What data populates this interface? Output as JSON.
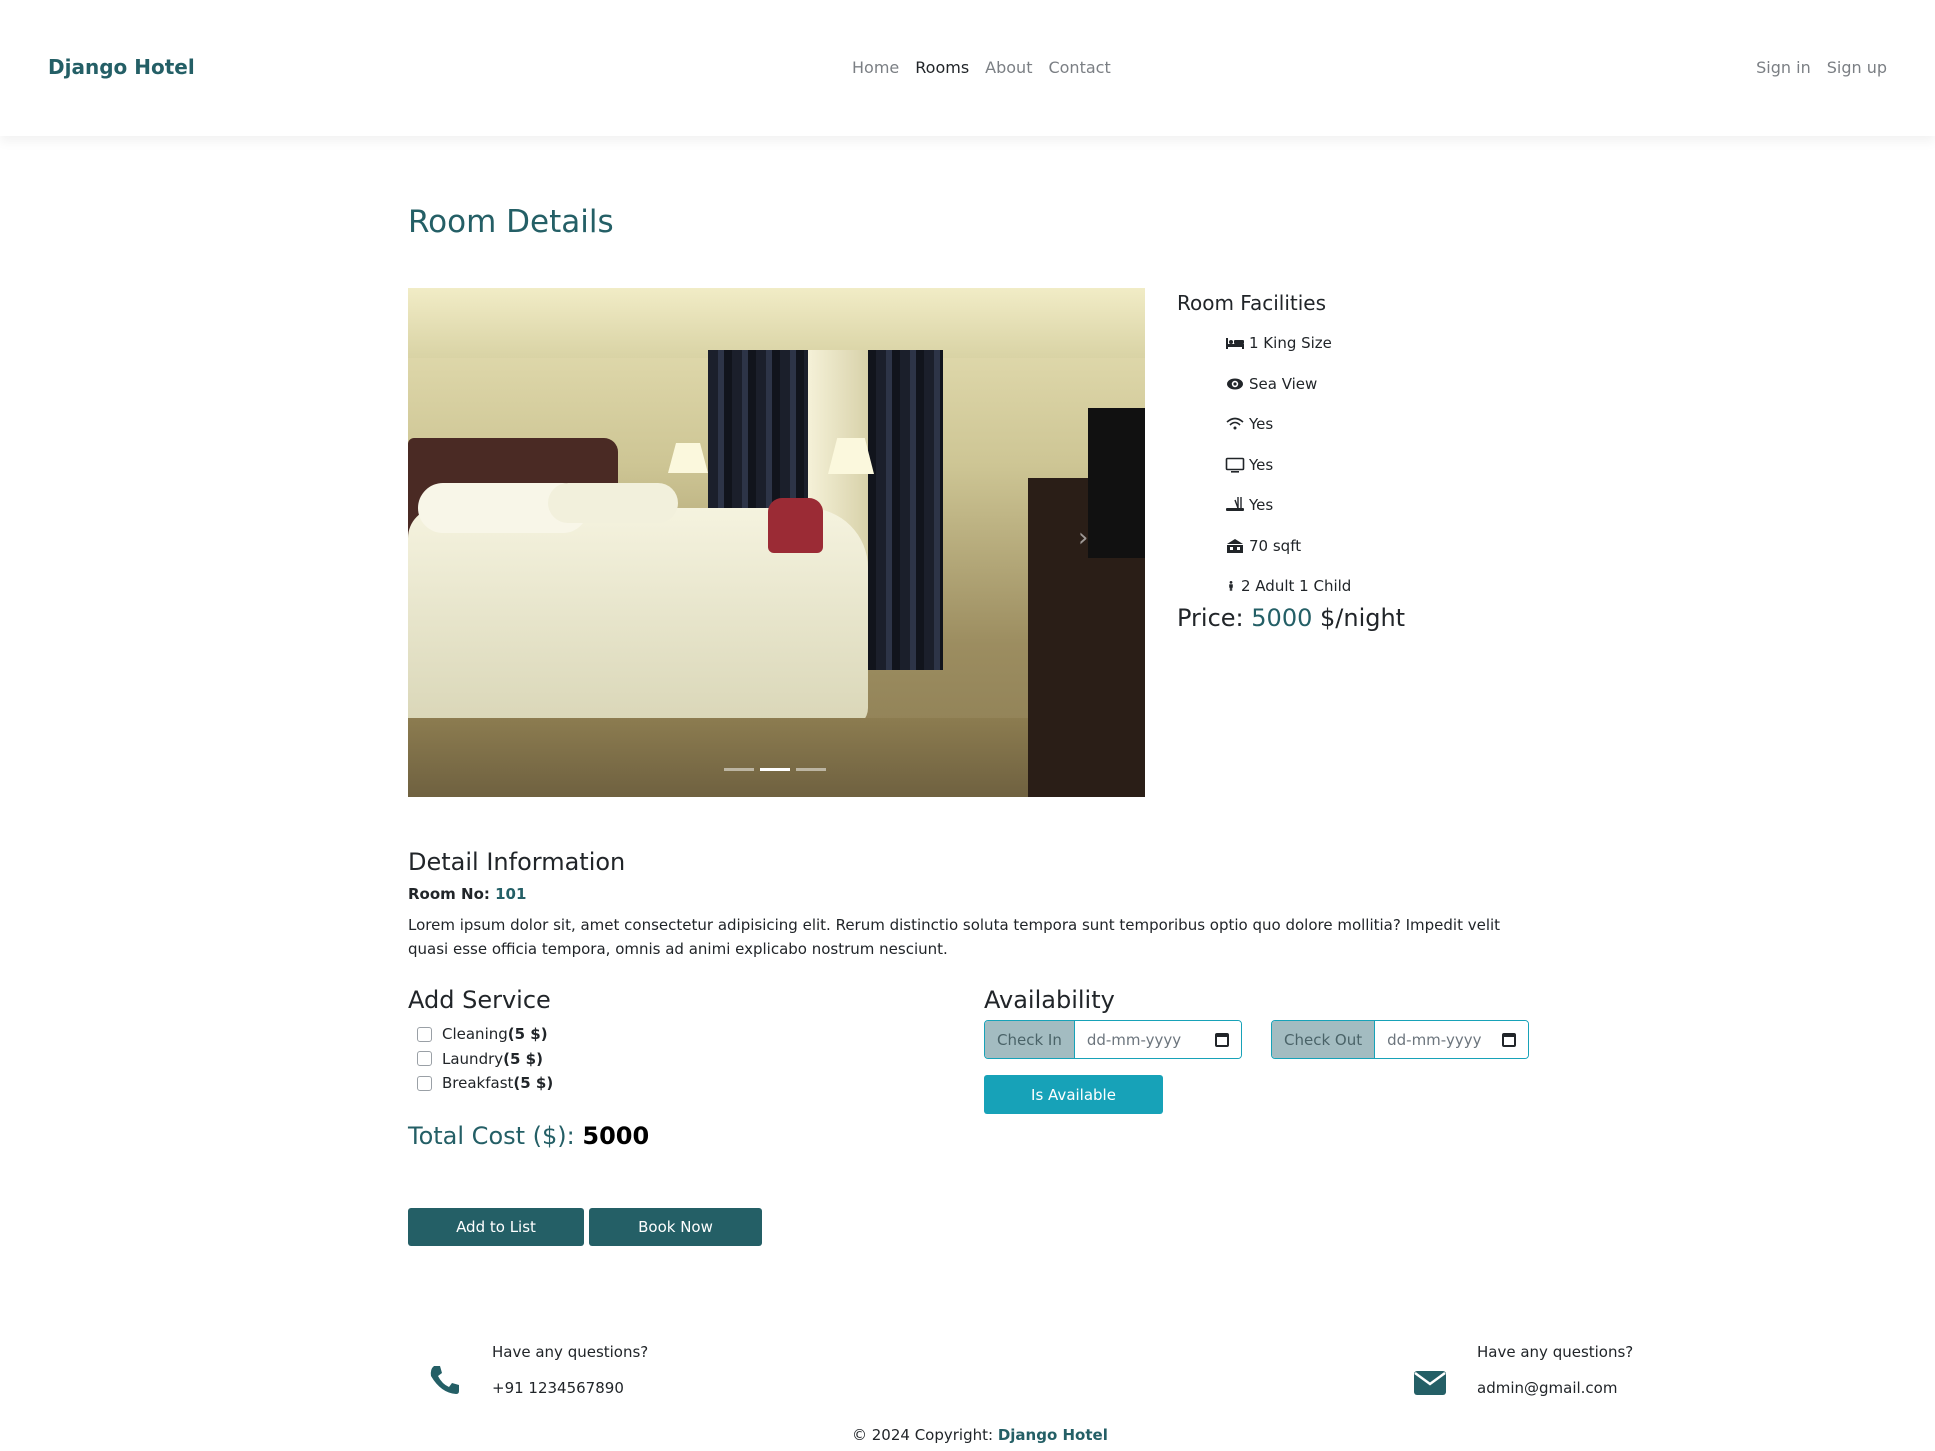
{
  "navbar": {
    "brand": "Django Hotel",
    "links": [
      "Home",
      "Rooms",
      "About",
      "Contact"
    ],
    "auth": [
      "Sign in",
      "Sign up"
    ]
  },
  "page_title": "Room Details",
  "facilities": {
    "title": "Room Facilities",
    "items": [
      {
        "icon": "bed-icon",
        "label": "1 King Size"
      },
      {
        "icon": "eye-icon",
        "label": "Sea View"
      },
      {
        "icon": "wifi-icon",
        "label": "Yes"
      },
      {
        "icon": "tv-icon",
        "label": "Yes"
      },
      {
        "icon": "shower-icon",
        "label": "Yes"
      },
      {
        "icon": "area-icon",
        "label": "70 sqft"
      },
      {
        "icon": "person-icon",
        "label": "2 Adult 1 Child"
      }
    ]
  },
  "price": {
    "label": "Price:",
    "value": "5000",
    "unit": "$/night"
  },
  "detail": {
    "title": "Detail Information",
    "room_label": "Room No:",
    "room_no": "101",
    "description": "Lorem ipsum dolor sit, amet consectetur adipisicing elit. Rerum distinctio soluta tempora sunt temporibus optio quo dolore mollitia? Impedit velit quasi esse officia tempora, omnis ad animi explicabo nostrum nesciunt."
  },
  "service": {
    "title": "Add Service",
    "items": [
      {
        "name": "Cleaning",
        "price": "(5 $)"
      },
      {
        "name": "Laundry",
        "price": "(5 $)"
      },
      {
        "name": "Breakfast",
        "price": "(5 $)"
      }
    ],
    "total_label": "Total Cost ($):",
    "total_value": "5000"
  },
  "availability": {
    "title": "Availability",
    "check_in_label": "Check In",
    "check_in_placeholder": "dd-mm-yyyy",
    "check_out_label": "Check Out",
    "check_out_placeholder": "dd-mm-yyyy",
    "button": "Is Available"
  },
  "actions": {
    "add": "Add to List",
    "book": "Book Now"
  },
  "footer": {
    "phone_question": "Have any questions?",
    "phone": "+91 1234567890",
    "mail_question": "Have any questions?",
    "email": "admin@gmail.com",
    "copyright_prefix": "© 2024 Copyright:",
    "copyright_brand": "Django Hotel"
  },
  "colors": {
    "brand": "#245f66",
    "accent": "#17a2b8"
  }
}
